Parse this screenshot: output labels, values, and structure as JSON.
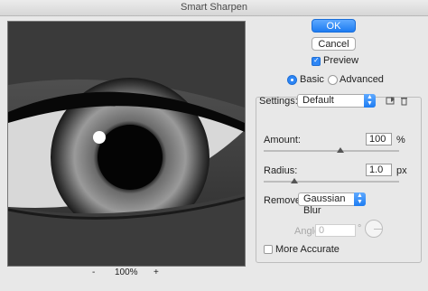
{
  "window": {
    "title": "Smart Sharpen"
  },
  "buttons": {
    "ok": "OK",
    "cancel": "Cancel"
  },
  "preview_checkbox": {
    "label": "Preview",
    "checked": true
  },
  "mode": {
    "basic": "Basic",
    "advanced": "Advanced",
    "selected": "Basic"
  },
  "settings": {
    "label": "Settings:",
    "value": "Default",
    "amount": {
      "label": "Amount:",
      "value": "100",
      "unit": "%"
    },
    "radius": {
      "label": "Radius:",
      "value": "1.0",
      "unit": "px"
    },
    "remove": {
      "label": "Remove:",
      "value": "Gaussian Blur"
    },
    "angle": {
      "label": "Angle:",
      "value": "0",
      "unit": "°"
    },
    "more_accurate": {
      "label": "More Accurate",
      "checked": false
    }
  },
  "zoom": {
    "minus": "-",
    "level": "100%",
    "plus": "+"
  },
  "colors": {
    "accent": "#1e7cf2"
  },
  "icons": {
    "save_preset": "save-preset-icon",
    "delete_preset": "trash-icon"
  }
}
